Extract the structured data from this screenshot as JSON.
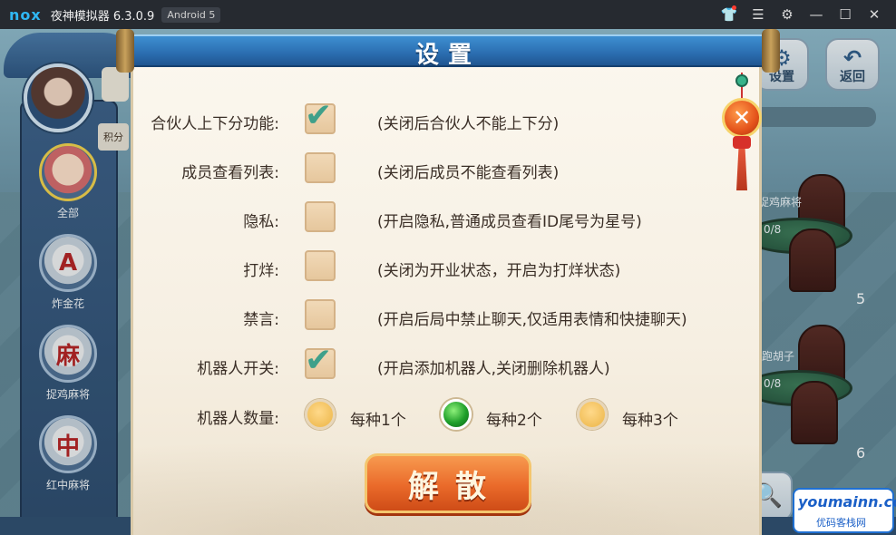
{
  "titlebar": {
    "logo": "nox",
    "title": "夜神模拟器 6.3.0.9",
    "android": "Android 5",
    "icons": [
      "shirt-icon",
      "menu-icon",
      "gear-icon",
      "minimize-icon",
      "maximize-icon",
      "close-icon"
    ]
  },
  "sidebar": {
    "score_label": "积分",
    "items": [
      {
        "label": "全部",
        "icon": "girl-avatar-icon"
      },
      {
        "label": "炸金花",
        "icon": "poker-cards-icon",
        "glyph": "A"
      },
      {
        "label": "捉鸡麻将",
        "icon": "mahjong-tile-icon",
        "glyph": "麻"
      },
      {
        "label": "红中麻将",
        "icon": "red-zhong-tile-icon",
        "glyph": "中"
      }
    ]
  },
  "top_buttons": {
    "settings": "设置",
    "back": "返回"
  },
  "tables": [
    {
      "label": "捉鸡麻将",
      "count": "0/8",
      "num": "5"
    },
    {
      "label": "跑胡子",
      "count": "0/8",
      "num": "6"
    }
  ],
  "dialog": {
    "title": "设置",
    "rows": [
      {
        "label": "合伙人上下分功能:",
        "checked": true,
        "desc": "(关闭后合伙人不能上下分)"
      },
      {
        "label": "成员查看列表:",
        "checked": false,
        "desc": "(关闭后成员不能查看列表)"
      },
      {
        "label": "隐私:",
        "checked": false,
        "desc": "(开启隐私,普通成员查看ID尾号为星号)"
      },
      {
        "label": "打烊:",
        "checked": false,
        "desc": "(关闭为开业状态，开启为打烊状态)"
      },
      {
        "label": "禁言:",
        "checked": false,
        "desc": "(开启后局中禁止聊天,仅适用表情和快捷聊天)"
      },
      {
        "label": "机器人开关:",
        "checked": true,
        "desc": "(开启添加机器人,关闭删除机器人)"
      }
    ],
    "robot_count": {
      "label": "机器人数量:",
      "options": [
        "每种1个",
        "每种2个",
        "每种3个"
      ],
      "selected_index": 1
    },
    "dissolve_button": "解散",
    "close_glyph": "✕"
  },
  "watermark": {
    "main": "youmainn.com",
    "sub": "优码客栈网"
  },
  "colors": {
    "title_blue": "#2c70b3",
    "check_green": "#3fa08a",
    "radio_on": "#1f9f2a",
    "button_orange": "#ea6a2a"
  }
}
